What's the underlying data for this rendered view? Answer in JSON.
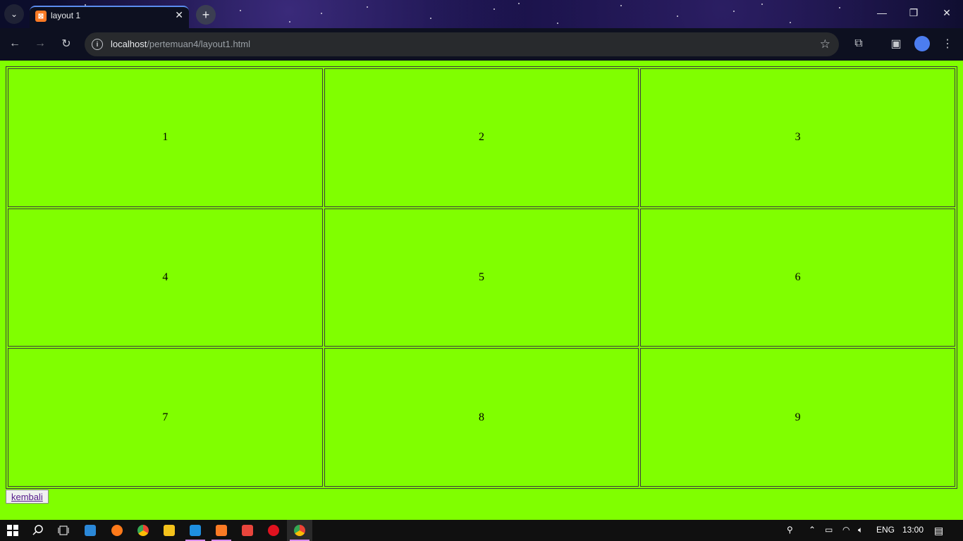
{
  "browser": {
    "tab_title": "layout 1",
    "url_host": "localhost",
    "url_path": "/pertemuan4/layout1.html",
    "favicon_letter": "⊠"
  },
  "page": {
    "background": "#80ff00",
    "cells": [
      [
        "1",
        "2",
        "3"
      ],
      [
        "4",
        "5",
        "6"
      ],
      [
        "7",
        "8",
        "9"
      ]
    ],
    "back_link": "kembali"
  },
  "taskbar": {
    "language": "ENG",
    "time": "13:00"
  }
}
